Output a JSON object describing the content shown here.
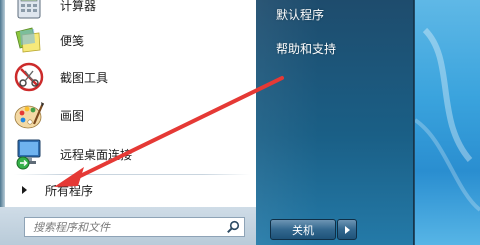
{
  "start_menu": {
    "programs": [
      {
        "label": "计算器",
        "icon": "calculator-icon"
      },
      {
        "label": "便笺",
        "icon": "sticky-notes-icon"
      },
      {
        "label": "截图工具",
        "icon": "snipping-tool-icon"
      },
      {
        "label": "画图",
        "icon": "paint-icon"
      },
      {
        "label": "远程桌面连接",
        "icon": "remote-desktop-icon"
      }
    ],
    "all_programs_label": "所有程序",
    "search_placeholder": "搜索程序和文件",
    "right_links": [
      {
        "label": "默认程序"
      },
      {
        "label": "帮助和支持"
      }
    ],
    "shutdown_label": "关机"
  },
  "annotation": {
    "arrow_color": "#e53935"
  }
}
